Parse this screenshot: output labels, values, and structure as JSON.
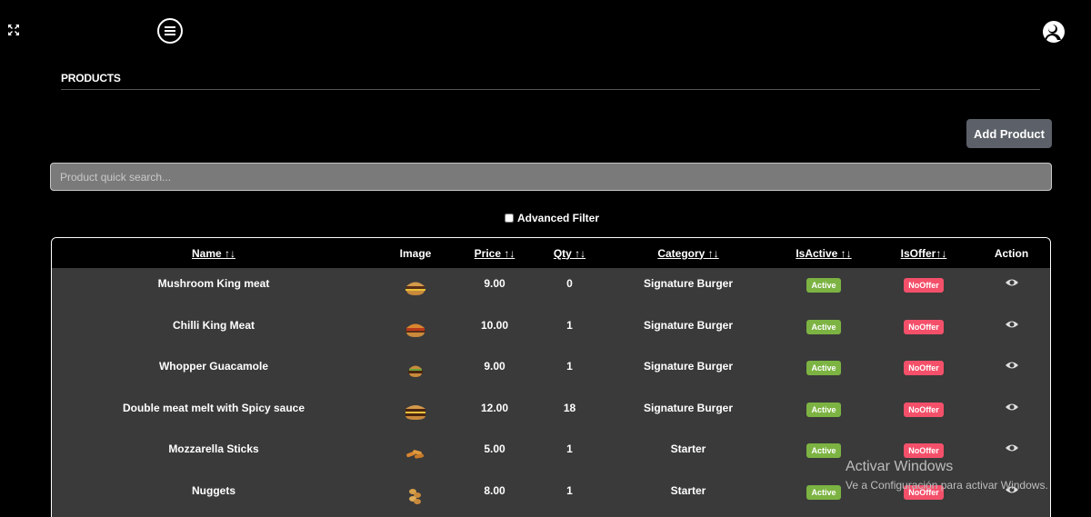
{
  "page": {
    "title": "PRODUCTS"
  },
  "toolbar": {
    "add_label": "Add Product"
  },
  "search": {
    "placeholder": "Product quick search..."
  },
  "filter": {
    "advanced_label": "Advanced Filter",
    "checked": false
  },
  "table": {
    "headers": {
      "name": "Name ↑↓",
      "image": "Image",
      "price": "Price ↑↓",
      "qty": "Qty ↑↓",
      "category": "Category ↑↓",
      "is_active": "IsActive ↑↓",
      "is_offer": "IsOffer↑↓",
      "action": "Action"
    },
    "rows": [
      {
        "name": "Mushroom King meat",
        "image": "burger-icon",
        "price": "9.00",
        "qty": "0",
        "category": "Signature Burger",
        "status": "Active",
        "offer": "NoOffer"
      },
      {
        "name": "Chilli King Meat",
        "image": "burger-icon",
        "price": "10.00",
        "qty": "1",
        "category": "Signature Burger",
        "status": "Active",
        "offer": "NoOffer"
      },
      {
        "name": "Whopper Guacamole",
        "image": "burger-icon",
        "price": "9.00",
        "qty": "1",
        "category": "Signature Burger",
        "status": "Active",
        "offer": "NoOffer"
      },
      {
        "name": "Double meat melt with Spicy sauce",
        "image": "burger-icon",
        "price": "12.00",
        "qty": "18",
        "category": "Signature Burger",
        "status": "Active",
        "offer": "NoOffer"
      },
      {
        "name": "Mozzarella Sticks",
        "image": "mozzarella-sticks-icon",
        "price": "5.00",
        "qty": "1",
        "category": "Starter",
        "status": "Active",
        "offer": "NoOffer"
      },
      {
        "name": "Nuggets",
        "image": "nuggets-icon",
        "price": "8.00",
        "qty": "1",
        "category": "Starter",
        "status": "Active",
        "offer": "NoOffer"
      }
    ]
  },
  "watermark": {
    "title": "Activar Windows",
    "subtitle": "Ve a Configuración para activar Windows."
  },
  "colors": {
    "background": "#000000",
    "table_body": "#3a3a3a",
    "active_badge": "#7cb342",
    "nooffer_badge": "#f4506a",
    "button": "#5c6169"
  },
  "icons": {
    "expand": "expand-icon",
    "menu": "hamburger-menu-icon",
    "user": "user-avatar-icon",
    "view": "eye-icon"
  }
}
